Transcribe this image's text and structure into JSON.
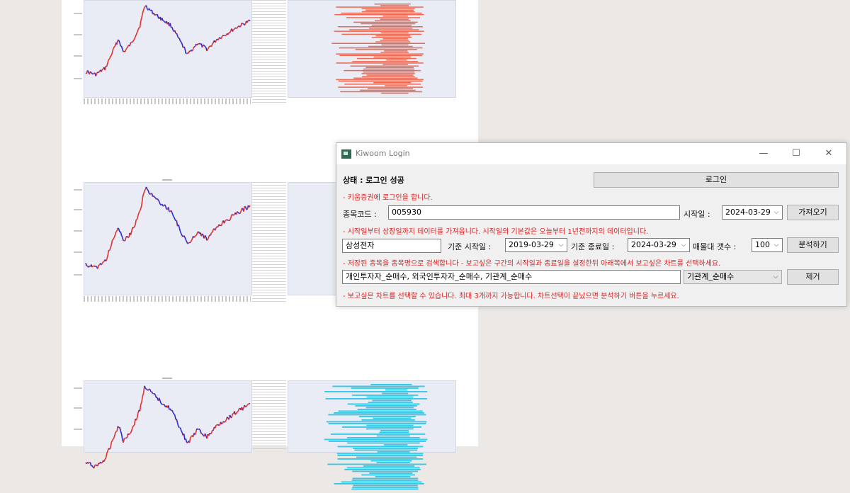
{
  "window": {
    "title": "Kiwoom Login",
    "minimize": "—",
    "maximize": "☐",
    "close": "✕"
  },
  "status": {
    "label": "상태 : 로그인 성공"
  },
  "login": {
    "button": "로그인",
    "note": "- 키움증권에 로그인을 합니다."
  },
  "fetch": {
    "code_label": "종목코드 :",
    "code_value": "005930",
    "start_label": "시작일 :",
    "start_value": "2024-03-29",
    "button": "가져오기",
    "note": "- 시작일부터 상장일까지 데이터를 가져옵니다. 시작일의 기본값은 오늘부터 1년전까지의 데이터입니다."
  },
  "analyze": {
    "stock_name": "삼성전자",
    "base_start_label": "기준 시작일 :",
    "base_start_value": "2019-03-29",
    "base_end_label": "기준 종료일 :",
    "base_end_value": "2024-03-29",
    "volume_count_label": "매물대 갯수 :",
    "volume_count_value": "100",
    "button": "분석하기",
    "note": "- 저장된 종목을 종목명으로 검색합니다 - 보고싶은 구간의 시작일과 종료일을 설정한뒤 아래쪽에서 보고싶은 차트를 선택하세요."
  },
  "charts": {
    "selected": "개인투자자_순매수, 외국인투자자_순매수, 기관계_순매수",
    "dropdown_value": "기관계_순매수",
    "remove_button": "제거",
    "note": "- 보고싶은 차트를 선택할 수 있습니다. 최대 3개까지 가능합니다. 차트선택이 끝났으면 분석하기 버튼을 누르세요."
  },
  "colors": {
    "note_red": "#e02020",
    "vol_red": "#ec6b56",
    "vol_purple": "#9b5de5",
    "vol_cyan": "#37c8e8",
    "price_up": "#e0312b",
    "price_down": "#2a2ad0"
  }
}
